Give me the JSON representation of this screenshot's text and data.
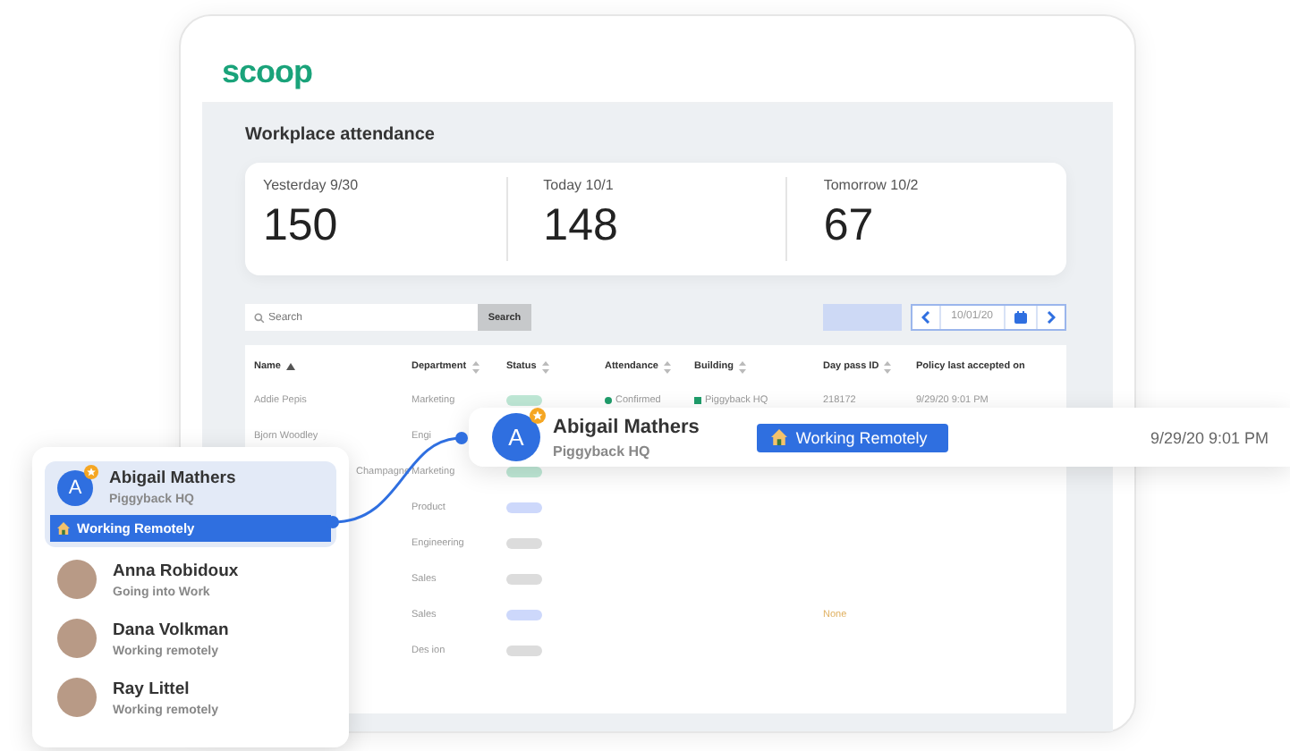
{
  "logo": "scoop",
  "page_title": "Workplace attendance",
  "stats": [
    {
      "label": "Yesterday 9/30",
      "value": "150"
    },
    {
      "label": "Today 10/1",
      "value": "148"
    },
    {
      "label": "Tomorrow 10/2",
      "value": "67"
    }
  ],
  "search": {
    "placeholder": "Search",
    "button": "Search"
  },
  "date_nav": {
    "value": "10/01/20"
  },
  "table": {
    "columns": [
      {
        "label": "Name",
        "sortable": true,
        "sorted": true
      },
      {
        "label": "Department",
        "sortable": true,
        "sorted": false
      },
      {
        "label": "Status",
        "sortable": true,
        "sorted": false
      },
      {
        "label": "Attendance",
        "sortable": true,
        "sorted": false
      },
      {
        "label": "Building",
        "sortable": true,
        "sorted": false
      },
      {
        "label": "Day pass ID",
        "sortable": true,
        "sorted": false
      },
      {
        "label": "Policy last accepted on",
        "sortable": false,
        "sorted": false
      }
    ],
    "rows": [
      {
        "kind": "full",
        "name": "Addie Pepis",
        "department": "Marketing",
        "color": "#bfe8d6",
        "attendance": "Confirmed",
        "building": "Piggyback HQ",
        "day_pass_id": "218172",
        "policy_accepted": "9/29/20 9:01 PM"
      },
      {
        "kind": "full",
        "name": "Bjorn Woodley",
        "department": "Engi"
      },
      {
        "kind": "cut",
        "name": "Champagne",
        "department": "Marketing",
        "color": "#bfe8d6"
      },
      {
        "kind": "full",
        "department": "Product",
        "color": "#cdd8fb"
      },
      {
        "kind": "full",
        "department": "Engineering",
        "color": "#dcdcdc"
      },
      {
        "kind": "full",
        "department": "Sales",
        "color": "#dcdcdc"
      },
      {
        "kind": "full",
        "department": "Sales",
        "color": "#cdd8fb",
        "day_pass_id": "None"
      },
      {
        "kind": "full",
        "department": "Des ion",
        "color": "#dcdcdc"
      }
    ]
  },
  "people": [
    {
      "kind": "initial",
      "initial": "A",
      "starred": true,
      "name": "Abigail Mathers",
      "subtitle": "Piggyback HQ",
      "status": "Working Remotely",
      "selected": true
    },
    {
      "kind": "photo",
      "name": "Anna Robidoux",
      "subtitle": "Going into Work",
      "selected": false
    },
    {
      "kind": "photo",
      "name": "Dana Volkman",
      "subtitle": "Working remotely",
      "selected": false
    },
    {
      "kind": "photo",
      "name": "Ray Littel",
      "subtitle": "Working remotely",
      "selected": false
    }
  ],
  "detail": {
    "initial": "A",
    "starred": true,
    "name": "Abigail Mathers",
    "building": "Piggyback HQ",
    "status": "Working Remotely",
    "time": "9/29/20 9:01 PM"
  }
}
